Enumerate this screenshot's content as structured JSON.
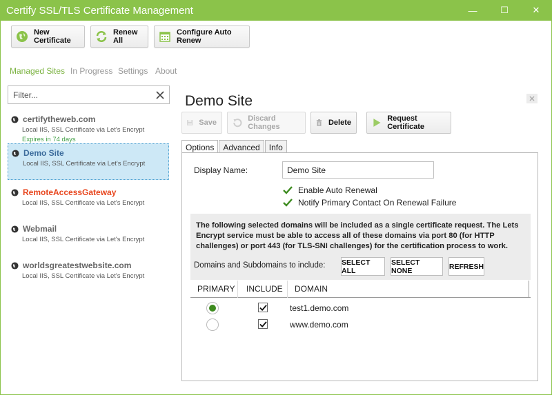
{
  "window": {
    "title": "Certify SSL/TLS Certificate Management",
    "controls": {
      "minimize": "—",
      "maximize": "☐",
      "close": "✕"
    }
  },
  "toolbar": {
    "new_certificate": "New Certificate",
    "renew_all": "Renew All",
    "configure_auto_renew": "Configure Auto Renew"
  },
  "nav_tabs": [
    "Managed Sites",
    "In Progress",
    "Settings",
    "About"
  ],
  "filter": {
    "placeholder": "Filter...",
    "value": ""
  },
  "sites": [
    {
      "name": "certifytheweb.com",
      "desc": "Local IIS, SSL Certificate via Let's Encrypt",
      "expires": "Expires in 74 days"
    },
    {
      "name": "Demo Site",
      "desc": "Local IIS, SSL Certificate via Let's Encrypt"
    },
    {
      "name": "RemoteAccessGateway",
      "desc": "Local IIS, SSL Certificate via Let's Encrypt"
    },
    {
      "name": "Webmail",
      "desc": "Local IIS, SSL Certificate via Let's Encrypt"
    },
    {
      "name": "worldsgreatestwebsite.com",
      "desc": "Local IIS, SSL Certificate via Let's Encrypt"
    }
  ],
  "detail": {
    "title": "Demo Site",
    "actions": {
      "save": "Save",
      "discard": "Discard Changes",
      "delete": "Delete",
      "request": "Request Certificate"
    },
    "tabs": [
      "Options",
      "Advanced",
      "Info"
    ],
    "display_name_label": "Display Name:",
    "display_name_value": "Demo Site",
    "enable_auto_renewal": "Enable Auto Renewal",
    "notify_contact": "Notify Primary Contact On Renewal Failure",
    "info_text": "The following selected domains will be included as a single certificate request. The Lets Encrypt service must be able to access all of these domains via port 80 (for HTTP challenges) or port 443 (for TLS-SNI challenges) for the certification process to work.",
    "domains_label": "Domains and Subdomains to include:",
    "select_all": "SELECT ALL",
    "select_none": "SELECT NONE",
    "refresh": "REFRESH",
    "columns": {
      "primary": "PRIMARY",
      "include": "INCLUDE",
      "domain": "DOMAIN"
    },
    "domains": [
      {
        "domain": "test1.demo.com",
        "primary": true,
        "include": true
      },
      {
        "domain": "www.demo.com",
        "primary": false,
        "include": true
      }
    ]
  },
  "colors": {
    "accent": "#8bc34a",
    "selected_bg": "#cde8f6",
    "red_site": "#e8461e",
    "expires": "#43a047"
  }
}
